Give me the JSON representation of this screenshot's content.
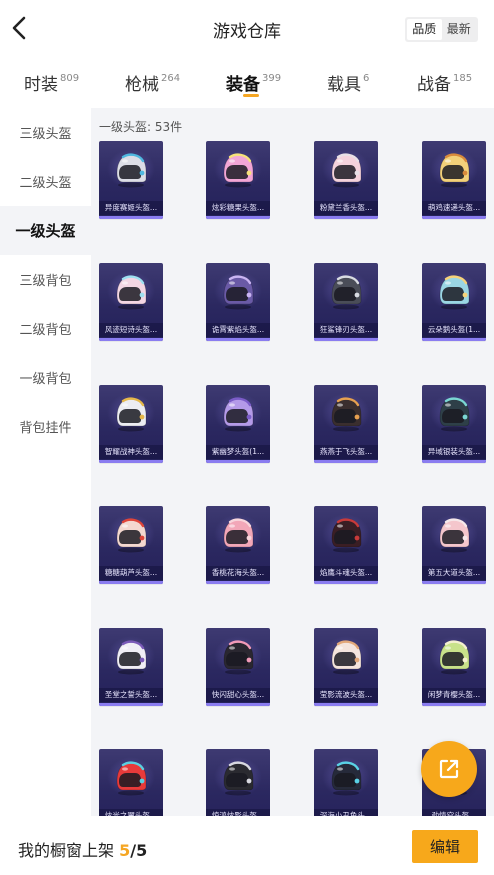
{
  "header": {
    "title": "游戏仓库",
    "sort_options": [
      "品质",
      "最新"
    ],
    "sort_selected": "品质"
  },
  "tabs": [
    {
      "label": "时装",
      "count": "809"
    },
    {
      "label": "枪械",
      "count": "264"
    },
    {
      "label": "装备",
      "count": "399",
      "active": true
    },
    {
      "label": "载具",
      "count": "6"
    },
    {
      "label": "战备",
      "count": "185"
    }
  ],
  "sidebar": {
    "items": [
      {
        "label": "三级头盔"
      },
      {
        "label": "二级头盔"
      },
      {
        "label": "一级头盔",
        "active": true
      },
      {
        "label": "三级背包"
      },
      {
        "label": "二级背包"
      },
      {
        "label": "一级背包"
      },
      {
        "label": "背包挂件"
      }
    ]
  },
  "section": {
    "title": "一级头盔: 53件"
  },
  "items": [
    {
      "name": "异度赛姬头盔...",
      "color": "#dcdde6",
      "accent": "#4fb8e0"
    },
    {
      "name": "炫彩糖果头盔...",
      "color": "#f2a6d6",
      "accent": "#f6e27a"
    },
    {
      "name": "粉黛兰香头盔...",
      "color": "#f4d2dc",
      "accent": "#e8e0e6"
    },
    {
      "name": "萌鸡速递头盔...",
      "color": "#f2d07a",
      "accent": "#d88a3c"
    },
    {
      "name": "风迹短诗头盔...",
      "color": "#f3d6e4",
      "accent": "#9ee0f0"
    },
    {
      "name": "诡霄紫焰头盔...",
      "color": "#6a5aa6",
      "accent": "#c9b4f2"
    },
    {
      "name": "狂鲨锋刃头盔...",
      "color": "#4a4d58",
      "accent": "#d8dbe2"
    },
    {
      "name": "云朵鹅头盔(1...",
      "color": "#9ad6e4",
      "accent": "#f5d27a"
    },
    {
      "name": "智耀战神头盔...",
      "color": "#ecedf2",
      "accent": "#e6b84a"
    },
    {
      "name": "紫幽梦头盔(1...",
      "color": "#b49ae8",
      "accent": "#7b5cc8"
    },
    {
      "name": "燕燕于飞头盔...",
      "color": "#3a2e2e",
      "accent": "#e6a050"
    },
    {
      "name": "异域银装头盔...",
      "color": "#2e3f48",
      "accent": "#7ad6d2"
    },
    {
      "name": "糖糖葫芦头盔...",
      "color": "#f4d8d0",
      "accent": "#e0453a"
    },
    {
      "name": "香桃花海头盔...",
      "color": "#f2a7b8",
      "accent": "#f8d6dc"
    },
    {
      "name": "焰鹰斗魂头盔...",
      "color": "#3a1e24",
      "accent": "#c83a3a"
    },
    {
      "name": "第五大道头盔...",
      "color": "#f4c6cc",
      "accent": "#f6e8ea"
    },
    {
      "name": "圣堂之誓头盔...",
      "color": "#f0eef6",
      "accent": "#7a5ab8"
    },
    {
      "name": "快闪甜心头盔...",
      "color": "#2a2730",
      "accent": "#f19ab8"
    },
    {
      "name": "莹影流波头盔...",
      "color": "#f4e4dc",
      "accent": "#e2a87a"
    },
    {
      "name": "闲梦青樱头盔...",
      "color": "#c8e28a",
      "accent": "#f4f0d0"
    },
    {
      "name": "炫光之翼头盔...",
      "color": "#e83a3a",
      "accent": "#5ad0e0"
    },
    {
      "name": "惊鸿炫影头盔...",
      "color": "#2a2a30",
      "accent": "#d8d8e0"
    },
    {
      "name": "深海小丑鱼头...",
      "color": "#262a3a",
      "accent": "#5ad2e6"
    },
    {
      "name": "劲情空头盔...",
      "color": "#f0eef2",
      "accent": "#d0a060"
    }
  ],
  "fab": {
    "icon": "share-external-icon"
  },
  "bottom": {
    "shelf_label": "我的橱窗上架",
    "shelf_count": "5",
    "shelf_total": "/5",
    "edit_label": "编辑"
  }
}
